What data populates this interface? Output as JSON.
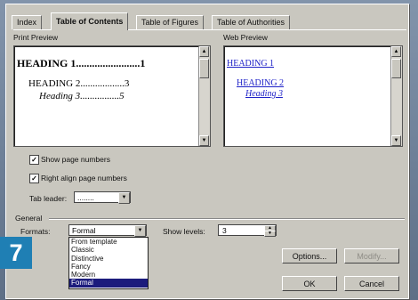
{
  "tabs": [
    {
      "label": "Index"
    },
    {
      "label": "Table of Contents"
    },
    {
      "label": "Table of Figures"
    },
    {
      "label": "Table of Authorities"
    }
  ],
  "print_preview": {
    "label": "Print Preview",
    "lines": [
      "HEADING 1........................1",
      "HEADING 2..................3",
      "Heading 3................5"
    ]
  },
  "web_preview": {
    "label": "Web Preview",
    "lines": [
      "HEADING 1",
      "HEADING 2",
      "Heading 3"
    ]
  },
  "options": {
    "show_page_numbers": {
      "label": "Show page numbers",
      "checked": true
    },
    "right_align": {
      "label": "Right align page numbers",
      "checked": true
    },
    "tab_leader": {
      "label": "Tab leader:",
      "value": "........"
    }
  },
  "general": {
    "label": "General",
    "formats_label": "Formats:",
    "formats_value": "Formal",
    "formats_options": [
      "From template",
      "Classic",
      "Distinctive",
      "Fancy",
      "Modern",
      "Formal"
    ],
    "show_levels_label": "Show levels:",
    "show_levels_value": "3"
  },
  "buttons": {
    "options": "Options...",
    "modify": "Modify...",
    "ok": "OK",
    "cancel": "Cancel"
  },
  "step_badge": "7"
}
